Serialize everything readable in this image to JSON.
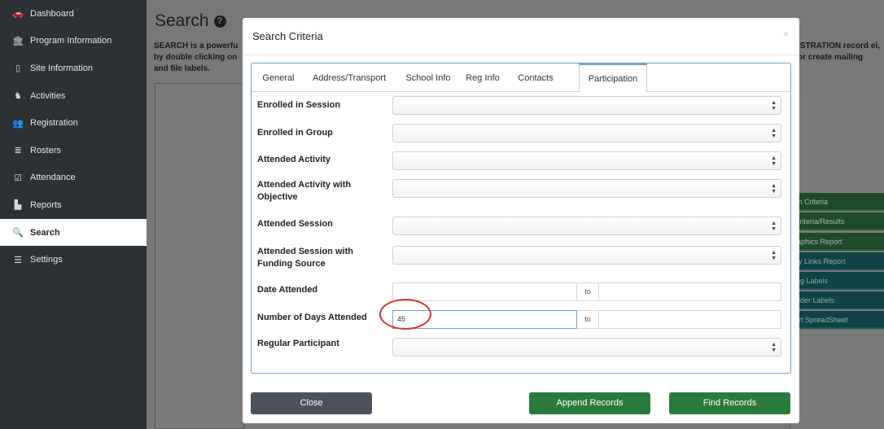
{
  "sidebar": {
    "items": [
      {
        "label": "Dashboard",
        "icon": "dashboard-icon",
        "glyph": "🚗"
      },
      {
        "label": "Program Information",
        "icon": "bank-icon",
        "glyph": "🏛"
      },
      {
        "label": "Site Information",
        "icon": "building-icon",
        "glyph": "▯"
      },
      {
        "label": "Activities",
        "icon": "activities-icon",
        "glyph": "♞"
      },
      {
        "label": "Registration",
        "icon": "users-icon",
        "glyph": "👥"
      },
      {
        "label": "Rosters",
        "icon": "list-icon",
        "glyph": "≣"
      },
      {
        "label": "Attendance",
        "icon": "calendar-check-icon",
        "glyph": "☑"
      },
      {
        "label": "Reports",
        "icon": "bar-chart-icon",
        "glyph": "▙"
      },
      {
        "label": "Search",
        "icon": "search-icon",
        "glyph": "🔍"
      },
      {
        "label": "Settings",
        "icon": "sliders-icon",
        "glyph": "☰"
      }
    ],
    "active_index": 8
  },
  "page": {
    "title": "Search",
    "desc_left": "SEARCH is a powerfu by double clicking on and file labels.",
    "desc_right": "ISTRATION record el, or create mailing"
  },
  "side_buttons": [
    {
      "label": "ch Criteria",
      "style": "green"
    },
    {
      "label": "Criteria/Results",
      "style": "green"
    },
    {
      "label": "raphics Report",
      "style": "green"
    },
    {
      "label": "ey Links Report",
      "style": "teal"
    },
    {
      "label": "ing Labels",
      "style": "teal"
    },
    {
      "label": "older Labels",
      "style": "teal"
    },
    {
      "label": "ort SpreadSheet",
      "style": "teal"
    }
  ],
  "modal": {
    "title": "Search Criteria",
    "close_glyph": "×",
    "tabs": [
      "General",
      "Address/Transport",
      "School Info",
      "Reg Info",
      "Contacts",
      "Participation"
    ],
    "active_tab": "Participation",
    "fields": {
      "enrolled_session": {
        "label": "Enrolled in Session",
        "value": ""
      },
      "enrolled_group": {
        "label": "Enrolled in Group",
        "value": ""
      },
      "attended_activity": {
        "label": "Attended Activity",
        "value": ""
      },
      "attended_activity_objective": {
        "label": "Attended Activity with Objective",
        "value": ""
      },
      "attended_session": {
        "label": "Attended Session",
        "value": ""
      },
      "attended_session_funding": {
        "label": "Attended Session with Funding Source",
        "value": ""
      },
      "date_attended": {
        "label": "Date Attended",
        "from": "",
        "to_label": "to",
        "to": ""
      },
      "days_attended": {
        "label": "Number of Days Attended",
        "from": "45",
        "to_label": "to",
        "to": ""
      },
      "regular_participant": {
        "label": "Regular Participant",
        "value": ""
      }
    },
    "buttons": {
      "close": "Close",
      "append": "Append Records",
      "find": "Find Records"
    }
  },
  "colors": {
    "sidebar_bg": "#2c3136",
    "tab_accent": "#6fa3cc",
    "green_button": "#2a7b3b",
    "gray_button": "#4b5259",
    "highlight_circle": "#d8312a"
  }
}
